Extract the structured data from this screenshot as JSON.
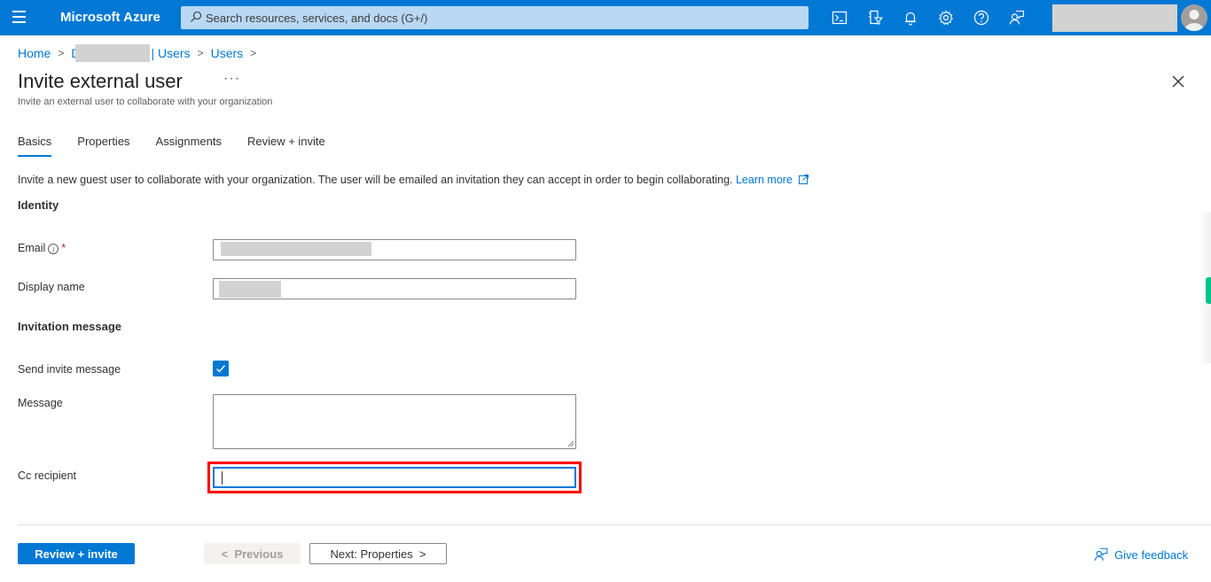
{
  "topbar": {
    "brand": "Microsoft Azure",
    "search_placeholder": "Search resources, services, and docs (G+/)",
    "icons": [
      "cloud-shell-icon",
      "directory-filter-icon",
      "notifications-icon",
      "settings-icon",
      "help-icon",
      "feedback-icon"
    ]
  },
  "breadcrumb": {
    "items": [
      "Home",
      "D",
      "| Users",
      "Users"
    ]
  },
  "page": {
    "title": "Invite external user",
    "more_label": "···",
    "subtitle": "Invite an external user to collaborate with your organization"
  },
  "tabs": [
    {
      "label": "Basics",
      "active": true
    },
    {
      "label": "Properties",
      "active": false
    },
    {
      "label": "Assignments",
      "active": false
    },
    {
      "label": "Review + invite",
      "active": false
    }
  ],
  "intro": {
    "text": "Invite a new guest user to collaborate with your organization. The user will be emailed an invitation they can accept in order to begin collaborating.",
    "link": "Learn more"
  },
  "identity": {
    "heading": "Identity",
    "email_label": "Email",
    "email_required": "*",
    "email_value": "",
    "display_name_label": "Display name",
    "display_name_value": ""
  },
  "invitation": {
    "heading": "Invitation message",
    "send_invite_label": "Send invite message",
    "send_invite_checked": true,
    "message_label": "Message",
    "message_value": "",
    "cc_label": "Cc recipient",
    "cc_value": ""
  },
  "footer": {
    "review_invite": "Review + invite",
    "previous": "Previous",
    "next": "Next: Properties",
    "feedback": "Give feedback"
  },
  "colors": {
    "accent": "#0078d4",
    "highlight": "#ff0000",
    "side_tab": "#00c48c"
  }
}
